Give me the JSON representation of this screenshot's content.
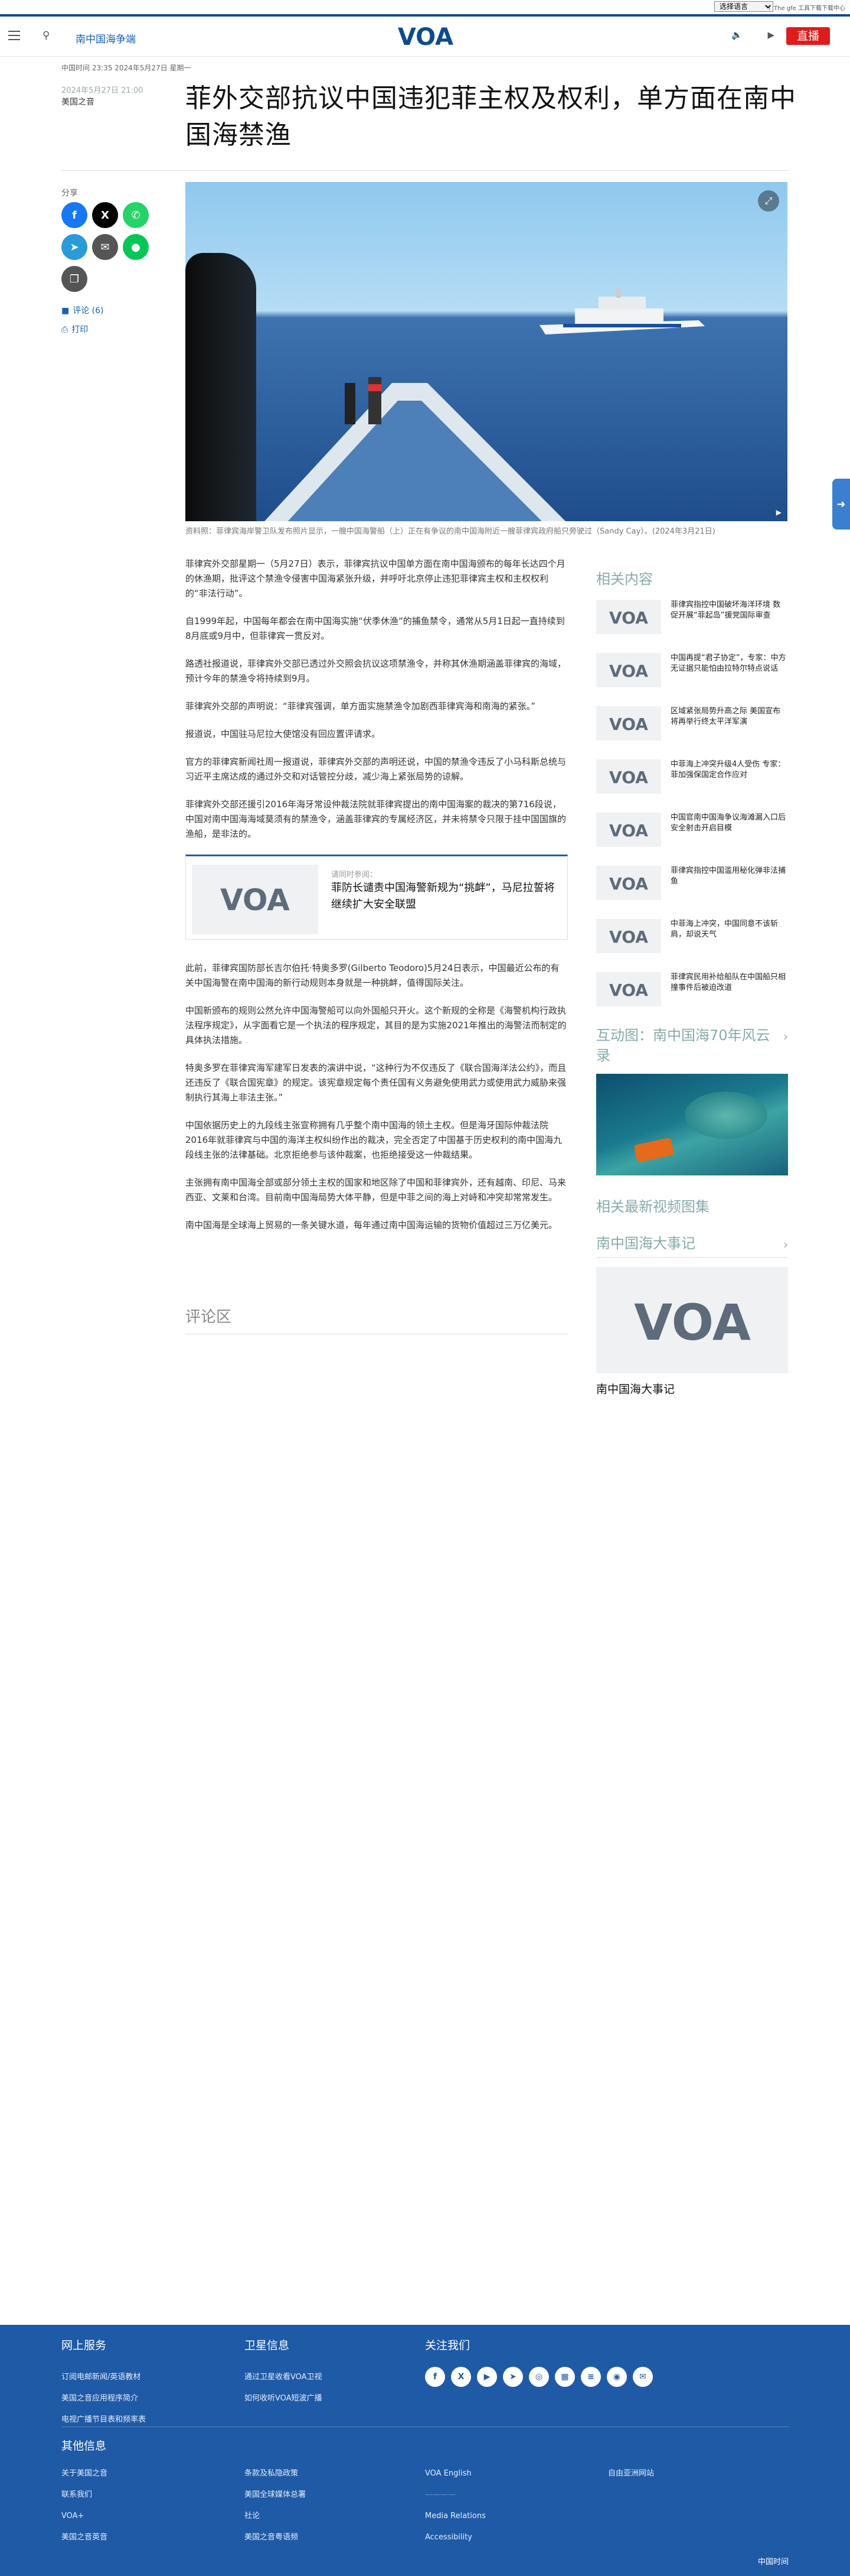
{
  "util": {
    "language_select": "选择语言",
    "links": "↑ The gfe  工具下载下载中心"
  },
  "header": {
    "section": "南中国海争端",
    "logo": "VOA",
    "live": "直播",
    "colors": {
      "brand": "#0d4b8c",
      "live": "#e01b1b",
      "link": "#1a5fb4"
    }
  },
  "article": {
    "dateline": "中国时间 23:35 2024年5月27日 星期一",
    "pub_date": "2024年5月27日 21:00",
    "author": "美国之音",
    "title": "菲外交部抗议中国违犯菲主权及权利，单方面在南中国海禁渔",
    "caption": "资料照：菲律宾海岸警卫队发布照片显示，一艘中国海警船（上）正在有争议的南中国海附近一艘菲律宾政府船只旁驶过（Sandy Cay）。(2024年3月21日)",
    "paragraphs_a": [
      "菲律宾外交部星期一（5月27日）表示，菲律宾抗议中国单方面在南中国海颁布的每年长达四个月的休渔期，批评这个禁渔令侵害中国海紧张升级，并呼吁北京停止违犯菲律宾主权和主权权利的“非法行动”。",
      "自1999年起，中国每年都会在南中国海实施“伏季休渔”的捕鱼禁令，通常从5月1日起一直持续到8月底或9月中，但菲律宾一贯反对。",
      "路透社报道说，菲律宾外交部已透过外交照会抗议这项禁渔令，并称其休渔期涵盖菲律宾的海域，预计今年的禁渔令将持续到9月。",
      "菲律宾外交部的声明说：“菲律宾强调，单方面实施禁渔令加剧西菲律宾海和南海的紧张。”",
      "报道说，中国驻马尼拉大使馆没有回应置评请求。",
      "官方的菲律宾新闻社周一报道说，菲律宾外交部的声明还说，中国的禁渔令违反了小马科斯总统与习近平主席达成的通过外交和对话管控分歧，减少海上紧张局势的谅解。",
      "菲律宾外交部还援引2016年海牙常设仲裁法院就菲律宾提出的南中国海案的裁决的第716段说，中国对南中国海海域莫须有的禁渔令，涵盖菲律宾的专属经济区，并未将禁令只限于挂中国国旗的渔船，是非法的。"
    ],
    "related_inline": {
      "kicker": "请同时参阅：",
      "title": "菲防长谴责中国海警新规为“挑衅”，马尼拉誓将继续扩大安全联盟"
    },
    "paragraphs_b": [
      "此前，菲律宾国防部长吉尔伯托·特奥多罗(Gilberto Teodoro)5月24日表示，中国最近公布的有关中国海警在南中国海的新行动规则本身就是一种挑衅，值得国际关注。",
      "中国新颁布的规则公然允许中国海警船可以向外国船只开火。这个新规的全称是《海警机构行政执法程序规定》，从字面看它是一个执法的程序规定，其目的是为实施2021年推出的海警法而制定的具体执法措施。",
      "特奥多罗在菲律宾海军建军日发表的演讲中说，“这种行为不仅违反了《联合国海洋法公约》，而且还违反了《联合国宪章》的规定。该宪章规定每个责任国有义务避免使用武力或使用武力威胁来强制执行其海上非法主张。”",
      "中国依据历史上的九段线主张宣称拥有几乎整个南中国海的领土主权。但是海牙国际仲裁法院2016年就菲律宾与中国的海洋主权纠纷作出的裁决，完全否定了中国基于历史权利的南中国海九段线主张的法律基础。北京拒绝参与该仲裁案，也拒绝接受这一仲裁结果。",
      "主张拥有南中国海全部或部分领土主权的国家和地区除了中国和菲律宾外，还有越南、印尼、马来西亚、文莱和台湾。目前南中国海局势大体平静，但是中菲之间的海上对峙和冲突却常常发生。",
      "南中国海是全球海上贸易的一条关键水道，每年通过南中国海运输的货物价值超过三万亿美元。"
    ],
    "comments_label": "评论区"
  },
  "share": {
    "label": "分享",
    "comments_link": "评论 (6)",
    "print_link": "打印"
  },
  "sidebar": {
    "related_title": "相关内容",
    "related_items": [
      "菲律宾指控中国破坏海洋环境 数促开展“菲起岛”援党国际审查",
      "中国再提“君子协定”，专家：中方无证据只能怕由拉特尔特点说话",
      "区域紧张局势升高之际 美国宣布将再举行终太平洋军演",
      "中菲海上冲突升级4人受伤 专家：菲加强保国定合作应对",
      "中国官南中国海争议海滩漏入口后安全射击开启目模",
      "菲律宾指控中国滥用秘化弹非法捕鱼",
      "中菲海上冲突，中国同意不该斩肩，却说天气",
      "菲律宾民用补给船队在中国船只相撞事件后被迫改道"
    ],
    "gallery_title": "互动图：南中国海70年风云录",
    "video_title": "相关最新视频图集",
    "feature_title": "南中国海大事记",
    "feature_label": "南中国海大事记"
  },
  "footer": {
    "col1_title": "网上服务",
    "col1_links": [
      "订阅电邮新闻/英语教材",
      "美国之音应用程序简介",
      "电视广播节目表和频率表"
    ],
    "col2_title": "卫星信息",
    "col2_links": [
      "通过卫星收看VOA卫视",
      "如何收听VOA短波广播"
    ],
    "col3_title": "关注我们",
    "social": [
      "f",
      "X",
      "▶",
      "➤",
      "◎",
      "▦",
      "≡",
      "◉",
      "✉"
    ],
    "other_title": "其他信息",
    "other_links": [
      [
        "关于美国之音",
        "联系我们",
        "VOA+",
        "美国之音英音"
      ],
      [
        "条款及私隐政策",
        "美国全球媒体总署",
        "社论",
        "美国之音粤语频"
      ],
      [
        "VOA English",
        "————",
        "Media Relations",
        "Accessibility"
      ],
      [
        "自由亚洲网站"
      ]
    ],
    "brand_bottom": "中国时间"
  }
}
